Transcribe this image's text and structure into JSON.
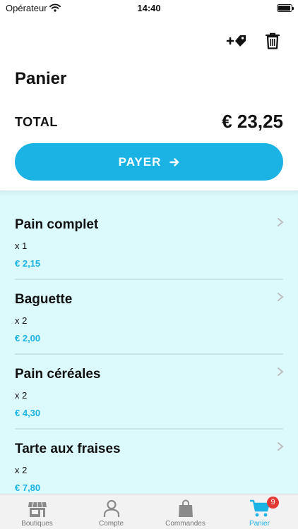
{
  "status_bar": {
    "carrier": "Opérateur",
    "time": "14:40"
  },
  "header": {
    "title": "Panier",
    "actions": [
      "add-tag-icon",
      "trash-icon"
    ]
  },
  "total": {
    "label": "TOTAL",
    "value": "€ 23,25"
  },
  "pay_button": {
    "label": "PAYER"
  },
  "items": [
    {
      "name": "Pain complet",
      "quantity": "x 1",
      "price": "€ 2,15"
    },
    {
      "name": "Baguette",
      "quantity": "x 2",
      "price": "€ 2,00"
    },
    {
      "name": "Pain céréales",
      "quantity": "x 2",
      "price": "€ 4,30"
    },
    {
      "name": "Tarte aux fraises",
      "quantity": "x 2",
      "price": "€ 7,80"
    }
  ],
  "tab_bar": {
    "tabs": [
      {
        "label": "Boutiques",
        "icon": "shop-icon",
        "active": false
      },
      {
        "label": "Compte",
        "icon": "user-icon",
        "active": false
      },
      {
        "label": "Commandes",
        "icon": "bag-icon",
        "active": false
      },
      {
        "label": "Panier",
        "icon": "cart-icon",
        "active": true,
        "badge": "9"
      }
    ]
  },
  "colors": {
    "accent": "#1bb3e3",
    "list_background": "#dcf9fc",
    "badge": "#e53935"
  }
}
